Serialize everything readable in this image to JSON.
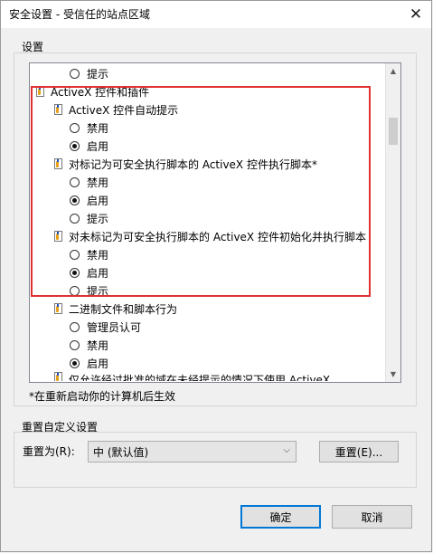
{
  "window": {
    "title": "安全设置 - 受信任的站点区域",
    "close_glyph": "✕"
  },
  "settings_group": {
    "label": "设置",
    "items": [
      {
        "kind": "radio",
        "label": "提示",
        "checked": false
      },
      {
        "kind": "category",
        "label": "ActiveX 控件和插件"
      },
      {
        "kind": "setting",
        "label": "ActiveX 控件自动提示"
      },
      {
        "kind": "radio",
        "label": "禁用",
        "checked": false
      },
      {
        "kind": "radio",
        "label": "启用",
        "checked": true
      },
      {
        "kind": "setting",
        "label": "对标记为可安全执行脚本的 ActiveX 控件执行脚本*"
      },
      {
        "kind": "radio",
        "label": "禁用",
        "checked": false
      },
      {
        "kind": "radio",
        "label": "启用",
        "checked": true
      },
      {
        "kind": "radio",
        "label": "提示",
        "checked": false
      },
      {
        "kind": "setting",
        "label": "对未标记为可安全执行脚本的 ActiveX 控件初始化并执行脚本"
      },
      {
        "kind": "radio",
        "label": "禁用",
        "checked": false
      },
      {
        "kind": "radio",
        "label": "启用",
        "checked": true
      },
      {
        "kind": "radio",
        "label": "提示",
        "checked": false
      },
      {
        "kind": "setting",
        "label": "二进制文件和脚本行为"
      },
      {
        "kind": "radio",
        "label": "管理员认可",
        "checked": false
      },
      {
        "kind": "radio",
        "label": "禁用",
        "checked": false
      },
      {
        "kind": "radio",
        "label": "启用",
        "checked": true
      },
      {
        "kind": "setting",
        "label": "仅允许经过批准的域在未经提示的情况下使用 ActiveX"
      }
    ],
    "scroll_up": "▲",
    "scroll_down": "▼"
  },
  "footnote": "*在重新启动你的计算机后生效",
  "reset_group": {
    "label": "重置自定义设置",
    "reset_to_label": "重置为(R):",
    "select_value": "中 (默认值)",
    "reset_button": "重置(E)..."
  },
  "buttons": {
    "ok": "确定",
    "cancel": "取消"
  }
}
